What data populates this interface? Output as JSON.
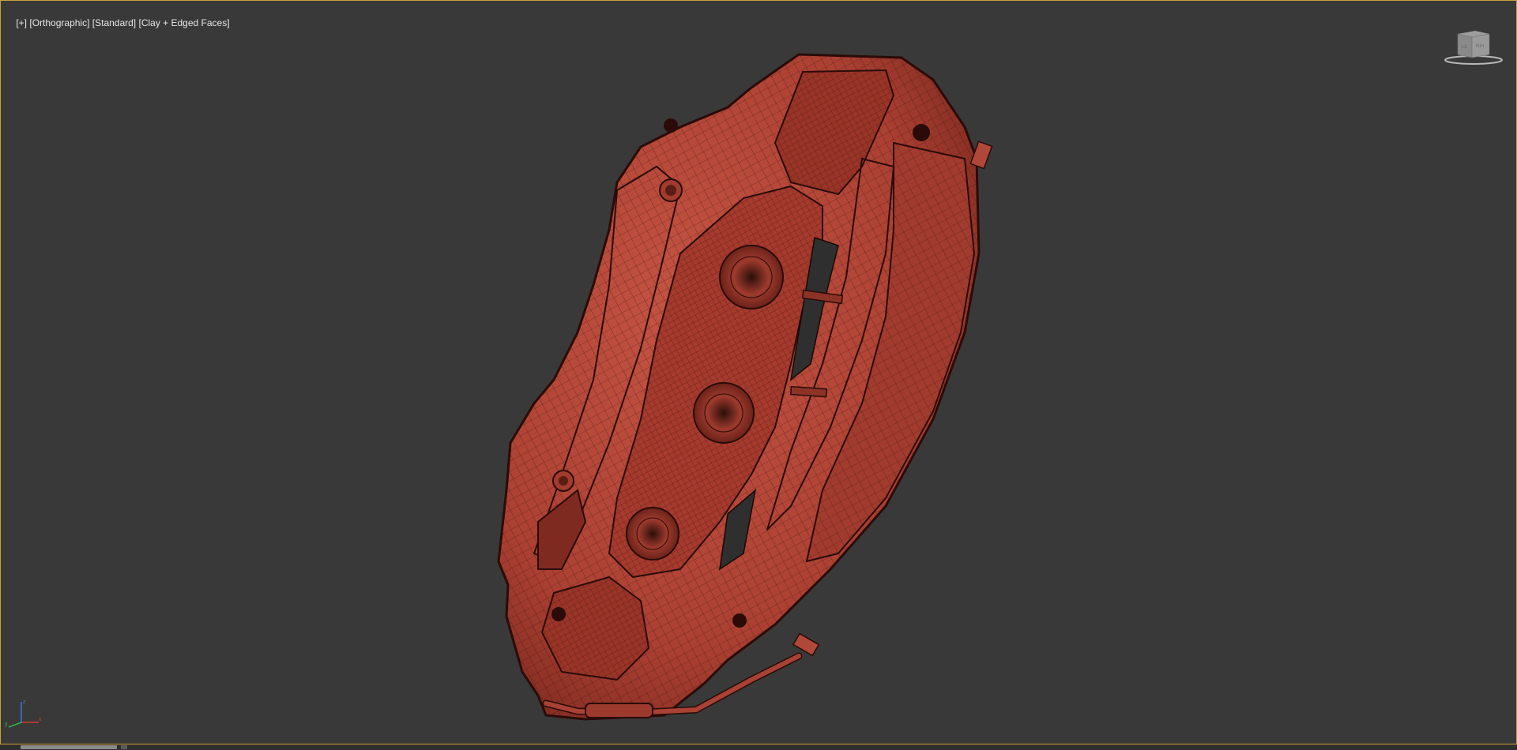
{
  "viewport": {
    "menu": {
      "plus": "[+]",
      "view": "[Orthographic]",
      "shading_preset": "[Standard]",
      "shading_mode": "[Clay + Edged Faces]"
    },
    "viewcube": {
      "left_face": "LE",
      "front_face": "RIH"
    },
    "axis_tripod": {
      "x": "x",
      "y": "y",
      "z": "z"
    },
    "colors": {
      "background": "#393939",
      "active_border": "#c8a23a",
      "clay": "#b8483a",
      "wire": "#3a120e"
    },
    "model": {
      "name": "brake-caliper"
    }
  },
  "icons": [
    "viewcube-icon",
    "axis-tripod-icon"
  ]
}
